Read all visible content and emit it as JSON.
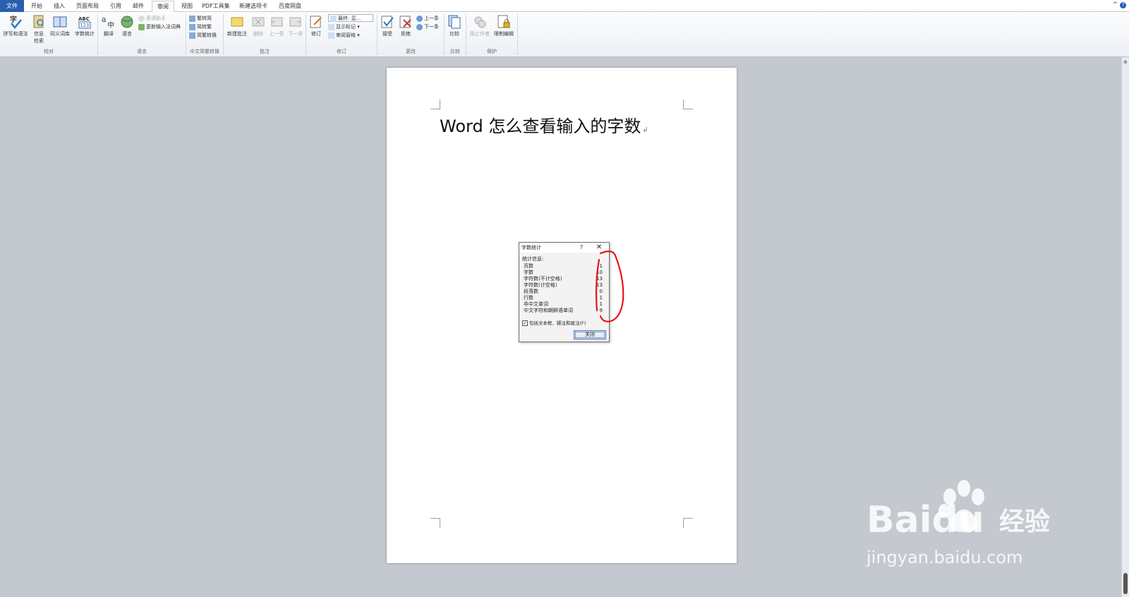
{
  "tabs": [
    {
      "label": "文件"
    },
    {
      "label": "开始"
    },
    {
      "label": "插入"
    },
    {
      "label": "页面布局"
    },
    {
      "label": "引用"
    },
    {
      "label": "邮件"
    },
    {
      "label": "审阅"
    },
    {
      "label": "视图"
    },
    {
      "label": "PDF工具集"
    },
    {
      "label": "新建选项卡"
    },
    {
      "label": "百度网盘"
    }
  ],
  "ribbon": {
    "proofing": {
      "label": "校对",
      "spelling": "拼写和语法",
      "research_line1": "信息",
      "research_line2": "检索",
      "thesaurus": "同义词库",
      "wordcount": "字数统计"
    },
    "language": {
      "label": "语言",
      "translate": "翻译",
      "language": "语言",
      "ime_assist": "英语助手",
      "update_ime": "更新输入法词典"
    },
    "chinese_conv": {
      "label": "中文简繁转换",
      "to_simplified": "繁转简",
      "to_traditional": "简转繁",
      "conversion": "简繁转换"
    },
    "comments": {
      "label": "批注",
      "new": "新建批注",
      "delete": "删除",
      "prev": "上一条",
      "next": "下一条"
    },
    "tracking": {
      "label": "修订",
      "track": "修订",
      "final": "最终: 显...",
      "show_markup": "显示标记",
      "review_pane": "审阅窗格"
    },
    "changes": {
      "label": "更改",
      "accept": "接受",
      "reject": "拒绝",
      "prev": "上一条",
      "next": "下一条"
    },
    "compare": {
      "label": "比较",
      "compare": "比较"
    },
    "protect": {
      "label": "保护",
      "block_authors": "阻止作者",
      "restrict": "限制编辑"
    }
  },
  "document": {
    "title": "Word 怎么查看输入的字数"
  },
  "dialog": {
    "title": "字数统计",
    "help": "?",
    "close": "✕",
    "stats_label": "统计信息:",
    "rows": [
      {
        "label": "页数",
        "value": "1"
      },
      {
        "label": "字数",
        "value": "10"
      },
      {
        "label": "字符数(不计空格)",
        "value": "13"
      },
      {
        "label": "字符数(计空格)",
        "value": "13"
      },
      {
        "label": "段落数",
        "value": "0"
      },
      {
        "label": "行数",
        "value": "1"
      },
      {
        "label": "非中文单词",
        "value": "1"
      },
      {
        "label": "中文字符和朝鲜语单词",
        "value": "9"
      }
    ],
    "checkbox_label": "包括文本框、脚注和尾注(F)",
    "close_button": "关闭"
  },
  "watermark": {
    "brand": "Baidu",
    "cn": "经验",
    "url": "jingyan.baidu.com"
  },
  "colors": {
    "accent": "#2a5fb0",
    "annotation": "#e8141b",
    "canvas": "#c4c9cf"
  }
}
